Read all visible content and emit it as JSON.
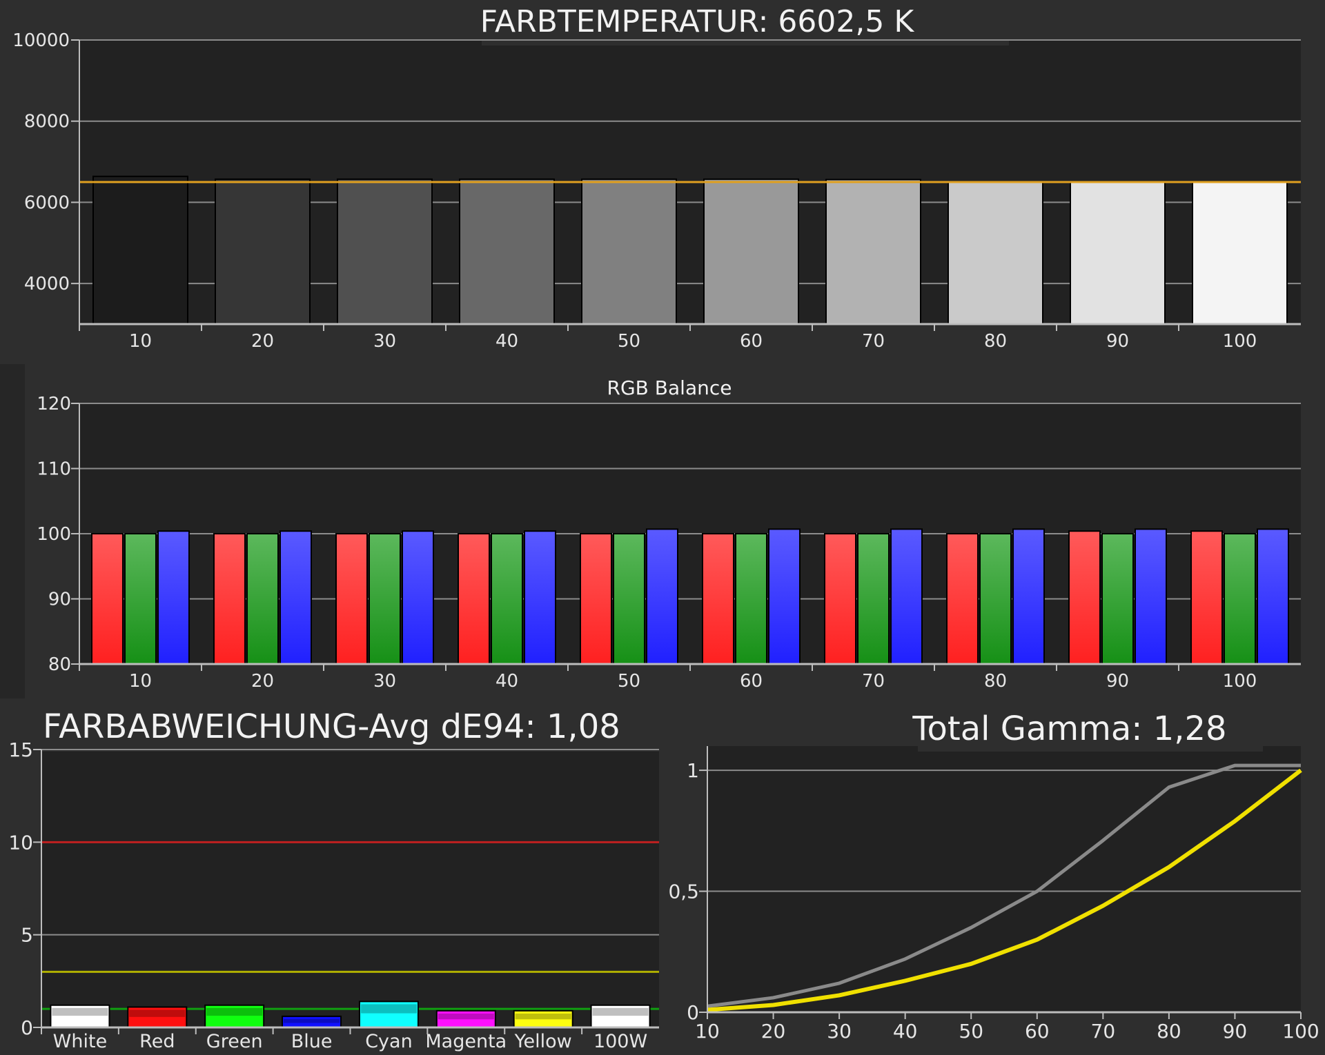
{
  "chart_data": [
    {
      "type": "bar",
      "title": "FARBTEMPERATUR: 6602,5 K",
      "categories": [
        "10",
        "20",
        "30",
        "40",
        "50",
        "60",
        "70",
        "80",
        "90",
        "100"
      ],
      "values": [
        6640,
        6570,
        6570,
        6570,
        6570,
        6570,
        6560,
        6500,
        6500,
        6500
      ],
      "reference_line": 6500,
      "ylim": [
        3000,
        10000
      ],
      "yticks": [
        "4000",
        "6000",
        "8000",
        "10000"
      ],
      "bar_colors": [
        "#1c1c1c",
        "#363636",
        "#505050",
        "#686868",
        "#808080",
        "#999999",
        "#b2b2b2",
        "#cacaca",
        "#e2e2e2",
        "#f4f4f4"
      ],
      "reference_color": "#e0a020",
      "grid": true
    },
    {
      "type": "bar",
      "title": "RGB Balance",
      "categories": [
        "10",
        "20",
        "30",
        "40",
        "50",
        "60",
        "70",
        "80",
        "90",
        "100"
      ],
      "series": [
        {
          "name": "",
          "color": "#ff2020",
          "values": [
            100,
            100,
            100,
            100,
            100,
            100,
            100,
            100,
            100.4,
            100.4
          ]
        },
        {
          "name": "",
          "color": "#169016",
          "values": [
            100,
            100,
            100,
            100,
            100,
            100,
            100,
            100,
            100,
            100
          ]
        },
        {
          "name": "",
          "color": "#2020ff",
          "values": [
            100.4,
            100.4,
            100.4,
            100.4,
            100.7,
            100.7,
            100.7,
            100.7,
            100.7,
            100.7
          ]
        }
      ],
      "ylim": [
        80,
        120
      ],
      "yticks": [
        "80",
        "90",
        "100",
        "110",
        "120"
      ],
      "grid": true
    },
    {
      "type": "bar",
      "title": "FARBABWEICHUNG-Avg dE94: 1,08",
      "categories": [
        "White",
        "Red",
        "Green",
        "Blue",
        "Cyan",
        "Magenta",
        "Yellow",
        "100W"
      ],
      "values": [
        1.2,
        1.1,
        1.2,
        0.6,
        1.4,
        0.9,
        0.9,
        1.2
      ],
      "bar_colors": [
        "#ffffff",
        "#ff1010",
        "#10ff10",
        "#1010ff",
        "#10ffff",
        "#ff10ff",
        "#ffff10",
        "#ffffff"
      ],
      "reference_lines": [
        {
          "value": 10,
          "color": "#c02020"
        },
        {
          "value": 3,
          "color": "#b0b000"
        },
        {
          "value": 1,
          "color": "#10a010"
        }
      ],
      "ylim": [
        0,
        15
      ],
      "yticks": [
        "0",
        "5",
        "10",
        "15"
      ],
      "grid": true
    },
    {
      "type": "line",
      "title": "Total Gamma: 1,28",
      "x": [
        10,
        20,
        30,
        40,
        50,
        60,
        70,
        80,
        90,
        100
      ],
      "series": [
        {
          "name": "",
          "color": "#8a8a8a",
          "values": [
            0.025,
            0.06,
            0.12,
            0.22,
            0.35,
            0.5,
            0.71,
            0.93,
            1.02,
            1.02
          ]
        },
        {
          "name": "",
          "color": "#f0e000",
          "values": [
            0.01,
            0.03,
            0.07,
            0.13,
            0.2,
            0.3,
            0.44,
            0.6,
            0.79,
            1.0
          ]
        }
      ],
      "xlim": [
        10,
        100
      ],
      "ylim": [
        0,
        1.1
      ],
      "xticks": [
        "10",
        "20",
        "30",
        "40",
        "50",
        "60",
        "70",
        "80",
        "90",
        "100"
      ],
      "yticks": [
        "0",
        "0,5",
        "1"
      ],
      "grid": true
    }
  ]
}
